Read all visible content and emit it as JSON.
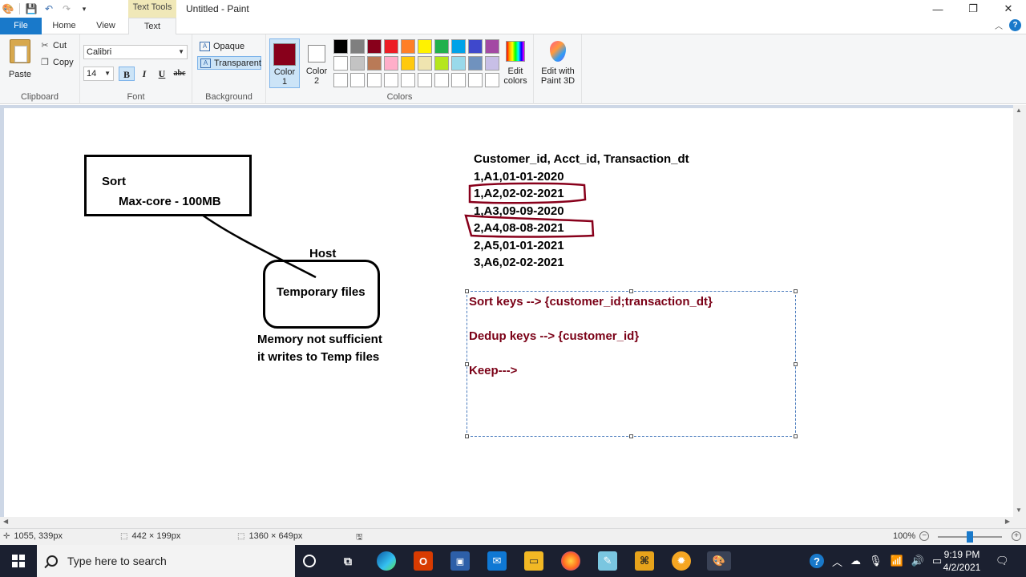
{
  "window": {
    "title": "Untitled - Paint",
    "contextual_tab": "Text Tools"
  },
  "tabs": [
    "File",
    "Home",
    "View",
    "Text"
  ],
  "ribbon": {
    "clipboard": {
      "paste": "Paste",
      "cut": "Cut",
      "copy": "Copy",
      "label": "Clipboard"
    },
    "font": {
      "family": "Calibri",
      "size": "14",
      "bold": "B",
      "italic": "I",
      "underline": "U",
      "strike": "abc",
      "label": "Font"
    },
    "background": {
      "opaque": "Opaque",
      "transparent": "Transparent",
      "label": "Background"
    },
    "colors": {
      "color1_label": "Color 1",
      "color2_label": "Color 2",
      "color1": "#88001b",
      "color2": "#ffffff",
      "edit_colors": "Edit colors",
      "label": "Colors",
      "palette": [
        "#000000",
        "#7f7f7f",
        "#88001b",
        "#ed1c24",
        "#ff7f27",
        "#fff200",
        "#22b14c",
        "#00a2e8",
        "#3f48cc",
        "#a349a4",
        "#ffffff",
        "#c3c3c3",
        "#b97a57",
        "#ffaec9",
        "#ffc90e",
        "#efe4b0",
        "#b5e61d",
        "#99d9ea",
        "#7092be",
        "#c8bfe7",
        "#ffffff",
        "#ffffff",
        "#ffffff",
        "#ffffff",
        "#ffffff",
        "#ffffff",
        "#ffffff",
        "#ffffff",
        "#ffffff",
        "#ffffff"
      ]
    },
    "paint3d": "Edit with Paint 3D"
  },
  "canvas": {
    "sort_title": "Sort",
    "max_core": "Max-core - 100MB",
    "host": "Host",
    "temp_files": "Temporary files",
    "memory_line1": "Memory not sufficient",
    "memory_line2": "it writes to Temp files",
    "table_header": "Customer_id, Acct_id, Transaction_dt",
    "rows": [
      "1,A1,01-01-2020",
      "1,A2,02-02-2021",
      "1,A3,09-09-2020",
      "2,A4,08-08-2021",
      "2,A5,01-01-2021",
      "3,A6,02-02-2021"
    ],
    "sort_keys": "Sort keys --> {customer_id;transaction_dt}",
    "dedup_keys": "Dedup keys -->  {customer_id}",
    "keep": "Keep--->"
  },
  "status": {
    "cursor": "1055, 339px",
    "selection": "442 × 199px",
    "canvas_size": "1360 × 649px",
    "zoom": "100%",
    "zoom_fraction": 0.5
  },
  "taskbar": {
    "search_placeholder": "Type here to search",
    "time": "9:19 PM",
    "date": "4/2/2021"
  }
}
